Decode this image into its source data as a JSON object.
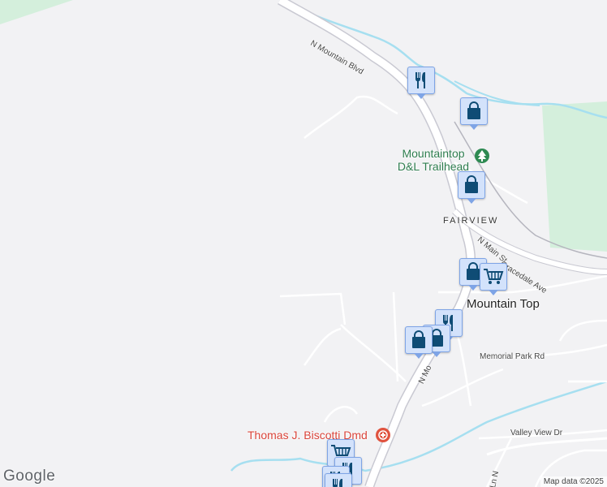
{
  "map": {
    "poi_labels": {
      "trailhead": "Mountaintop\nD&L Trailhead",
      "hospital": "Thomas J. Biscotti Dmd"
    },
    "places": {
      "fairview": "FAIRVIEW",
      "mountain_top": "Mountain Top"
    },
    "streets": {
      "n_mountain_blvd_top": "N Mountain Blvd",
      "n_mountain_blvd_bottom": "N Mo",
      "n_main": "N Main St",
      "gracedale": "Gracedale Ave",
      "memorial_park": "Memorial Park Rd",
      "valley_view": "Valley View Dr",
      "ln_n": "Ln N"
    },
    "markers": [
      {
        "icon": "restaurant-icon"
      },
      {
        "icon": "shopping-bag-icon"
      },
      {
        "icon": "shopping-bag-icon"
      },
      {
        "icon": "shopping-bag-icon"
      },
      {
        "icon": "shopping-cart-icon"
      },
      {
        "icon": "restaurant-icon"
      },
      {
        "icon": "shopping-bag-icon"
      },
      {
        "icon": "shopping-bag-icon"
      },
      {
        "icon": "shopping-cart-icon"
      },
      {
        "icon": "restaurant-icon"
      },
      {
        "icon": "restaurant-icon"
      },
      {
        "icon": "restaurant-icon"
      }
    ],
    "colors": {
      "background": "#f2f2f4",
      "park": "#d4efdc",
      "water": "#a6dff0",
      "road": "#ffffff",
      "road_casing": "#d0d0d6",
      "pin_fill": "#d3e2fb",
      "pin_border": "#7ea4e6",
      "icon": "#0f4c75",
      "trail_green": "#2e7d4f",
      "hospital_red": "#d9443a"
    }
  },
  "branding": {
    "logo": "Google",
    "attribution": "Map data ©2025"
  }
}
